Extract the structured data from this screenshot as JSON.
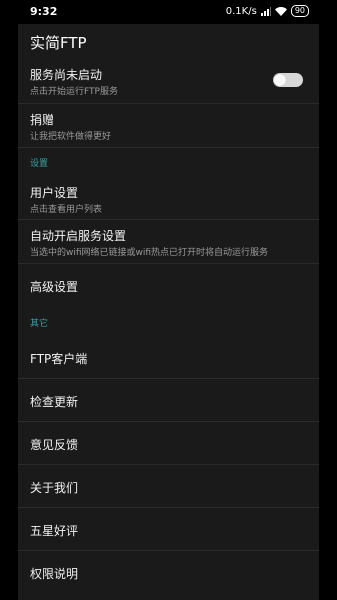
{
  "status_bar": {
    "time": "9:32",
    "speed": "0.1K/s",
    "battery": "90"
  },
  "app_title": "实简FTP",
  "service": {
    "title": "服务尚未启动",
    "subtitle": "点击开始运行FTP服务",
    "toggle_on": false
  },
  "donate": {
    "title": "捐赠",
    "subtitle": "让我把软件做得更好"
  },
  "section_settings": "设置",
  "user_settings": {
    "title": "用户设置",
    "subtitle": "点击查看用户列表"
  },
  "auto_start": {
    "title": "自动开启服务设置",
    "subtitle": "当选中的wifi网络已链接或wifi热点已打开时将自动运行服务"
  },
  "advanced": {
    "title": "高级设置"
  },
  "section_other": "其它",
  "other_items": [
    "FTP客户端",
    "检查更新",
    "意见反馈",
    "关于我们",
    "五星好评",
    "权限说明"
  ],
  "colors": {
    "background": "#1a1a1a",
    "section_accent": "#3aa3a3"
  }
}
